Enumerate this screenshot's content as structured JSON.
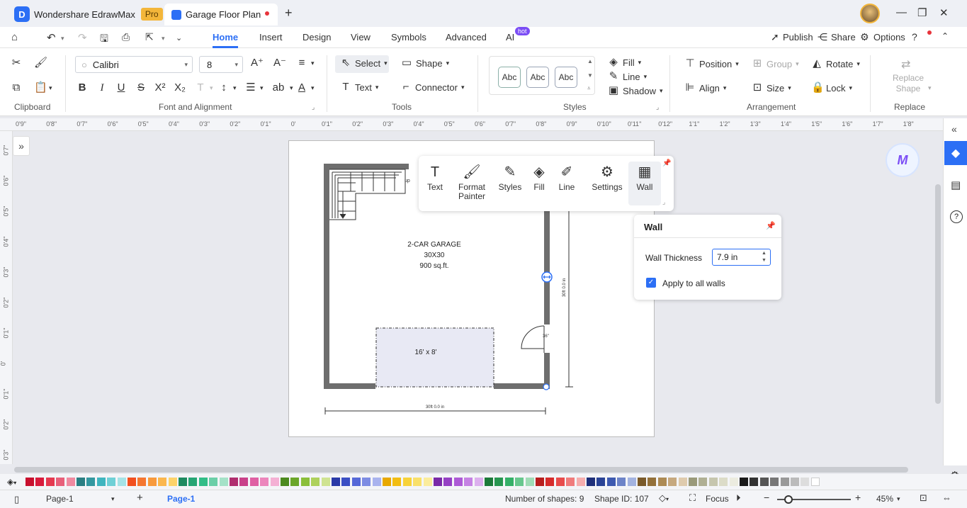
{
  "titlebar": {
    "app_name": "Wondershare EdrawMax",
    "badge": "Pro",
    "doc_tab": "Garage Floor Plan"
  },
  "menu": {
    "items": [
      "Home",
      "Insert",
      "Design",
      "View",
      "Symbols",
      "Advanced",
      "AI"
    ],
    "hot_badge": "hot",
    "publish": "Publish",
    "share": "Share",
    "options": "Options"
  },
  "ribbon": {
    "font_name": "Calibri",
    "font_size": "8",
    "select": "Select",
    "shape": "Shape",
    "text": "Text",
    "connector": "Connector",
    "fill": "Fill",
    "line": "Line",
    "shadow": "Shadow",
    "abc": "Abc",
    "position": "Position",
    "group": "Group",
    "rotate": "Rotate",
    "align": "Align",
    "size": "Size",
    "lock": "Lock",
    "replace_shape_1": "Replace",
    "replace_shape_2": "Shape",
    "groups": {
      "clipboard": "Clipboard",
      "font": "Font and Alignment",
      "tools": "Tools",
      "styles": "Styles",
      "arrangement": "Arrangement",
      "replace": "Replace"
    }
  },
  "rulers": {
    "h": [
      "0'9\"",
      "0'8\"",
      "0'7\"",
      "0'6\"",
      "0'5\"",
      "0'4\"",
      "0'3\"",
      "0'2\"",
      "0'1\"",
      "0'",
      "0'1\"",
      "0'2\"",
      "0'3\"",
      "0'4\"",
      "0'5\"",
      "0'6\"",
      "0'7\"",
      "0'8\"",
      "0'9\"",
      "0'10\"",
      "0'11\"",
      "0'12\"",
      "1'1\"",
      "1'2\"",
      "1'3\"",
      "1'4\"",
      "1'5\"",
      "1'6\"",
      "1'7\"",
      "1'8\""
    ],
    "v": [
      "0'7\"",
      "0'6\"",
      "0'5\"",
      "0'4\"",
      "0'3\"",
      "0'2\"",
      "0'1\"",
      "0'",
      "0'1\"",
      "0'2\"",
      "0'3\""
    ]
  },
  "drawing": {
    "title": "2-CAR GARAGE",
    "dims": "30X30",
    "area": "900 sq.ft.",
    "car_space": "16' x 8'",
    "stairs_label": "up",
    "dim_horizontal": "30ft 0.0 in",
    "dim_vertical": "30ft 0.0 in",
    "door_label": "36\""
  },
  "floatbar": {
    "items": [
      {
        "label": "Text",
        "icon": "text-icon"
      },
      {
        "label": "Format",
        "label2": "Painter",
        "icon": "format-painter-icon"
      },
      {
        "label": "Styles",
        "icon": "styles-icon"
      },
      {
        "label": "Fill",
        "icon": "fill-icon"
      },
      {
        "label": "Line",
        "icon": "line-icon"
      },
      {
        "label": "Settings",
        "icon": "settings-icon"
      },
      {
        "label": "Wall",
        "icon": "wall-icon"
      }
    ]
  },
  "wall_panel": {
    "title": "Wall",
    "thickness_label": "Wall Thickness",
    "thickness_value": "7.9 in",
    "apply_all_label": "Apply to all walls",
    "apply_all_checked": true
  },
  "status": {
    "page_select": "Page-1",
    "page_tab": "Page-1",
    "num_shapes": "Number of shapes: 9",
    "shape_id": "Shape ID: 107",
    "focus": "Focus",
    "zoom": "45%"
  },
  "palette": [
    "#c8102e",
    "#d81b3c",
    "#e53950",
    "#e8607a",
    "#f08aa0",
    "#2a7f83",
    "#3498a0",
    "#3fb5bf",
    "#6fd0d6",
    "#a5e3e6",
    "#f2501f",
    "#f57731",
    "#f89a3c",
    "#fbb74e",
    "#fdd36a",
    "#1e8a60",
    "#27a574",
    "#32bd87",
    "#6ccfa8",
    "#a5e2c8",
    "#b02e6f",
    "#c9418a",
    "#df5fa3",
    "#ec86bc",
    "#f4b0d4",
    "#4c8a1f",
    "#6ba62a",
    "#8bbf3a",
    "#aed15c",
    "#cfe391",
    "#2a3aa8",
    "#3b4fc4",
    "#5669d8",
    "#7d8ce3",
    "#a9b3ee",
    "#e8a800",
    "#f2bd12",
    "#f7d23a",
    "#f9e06a",
    "#fbec9c",
    "#7a2aa8",
    "#9540c4",
    "#ad5ad6",
    "#c582e3",
    "#dcb0ee",
    "#1c7a3a",
    "#279650",
    "#35b068",
    "#68c78e",
    "#a0dcb6",
    "#b81e1e",
    "#d62c2c",
    "#e84c4c",
    "#f07c7c",
    "#f6aeae",
    "#1e2f7a",
    "#2a4396",
    "#3e5ab0",
    "#6d84c8",
    "#a3b3e0",
    "#7a5a2a",
    "#94713a",
    "#ad8b55",
    "#c6a97f",
    "#dfcbad",
    "#9a9a7a",
    "#b0b094",
    "#c6c6ae",
    "#dcdcc8",
    "#ecece0",
    "#1a1a1a",
    "#333333",
    "#555555",
    "#777777",
    "#999999",
    "#bbbbbb",
    "#dddddd",
    "#ffffff"
  ]
}
